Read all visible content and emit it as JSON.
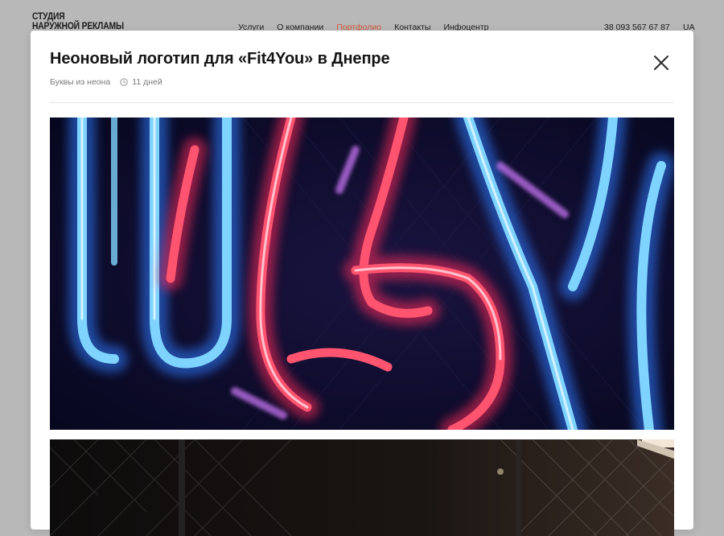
{
  "site": {
    "logo_line1": "СТУДИЯ",
    "logo_line2": "НАРУЖНОЙ РЕКЛАМЫ",
    "nav": [
      {
        "label": "Услуги"
      },
      {
        "label": "О компании"
      },
      {
        "label": "Портфолио",
        "active": true
      },
      {
        "label": "Контакты"
      },
      {
        "label": "Инфоцентр"
      }
    ],
    "phone": "38 093 567 67 87",
    "lang": "UA",
    "accent_color": "#d4573a"
  },
  "modal": {
    "title": "Неоновый логотип для «Fit4You» в Днепре",
    "category": "Буквы из неона",
    "duration": "11 дней",
    "close_icon": "close-icon",
    "clock_icon": "clock-icon"
  }
}
